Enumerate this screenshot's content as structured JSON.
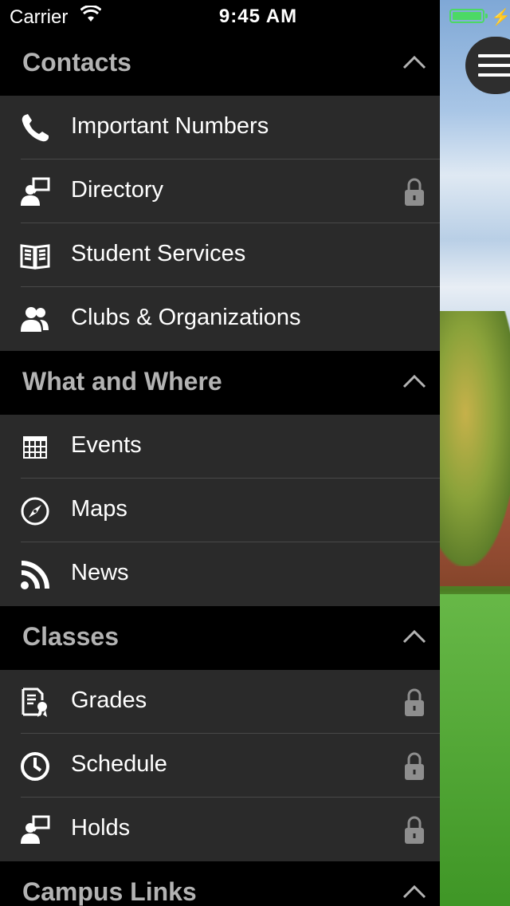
{
  "status_bar": {
    "carrier": "Carrier",
    "time": "9:45 AM",
    "battery_color": "#4cd964"
  },
  "menu_button": {
    "icon": "hamburger-menu-icon"
  },
  "sections": [
    {
      "title": "Contacts",
      "expanded": true,
      "items": [
        {
          "label": "Important Numbers",
          "icon": "phone-icon",
          "locked": false
        },
        {
          "label": "Directory",
          "icon": "person-chat-icon",
          "locked": true
        },
        {
          "label": "Student Services",
          "icon": "book-icon",
          "locked": false
        },
        {
          "label": "Clubs & Organizations",
          "icon": "people-icon",
          "locked": false
        }
      ]
    },
    {
      "title": "What and Where",
      "expanded": true,
      "items": [
        {
          "label": "Events",
          "icon": "calendar-icon",
          "locked": false
        },
        {
          "label": "Maps",
          "icon": "compass-icon",
          "locked": false
        },
        {
          "label": "News",
          "icon": "rss-icon",
          "locked": false
        }
      ]
    },
    {
      "title": "Classes",
      "expanded": true,
      "items": [
        {
          "label": "Grades",
          "icon": "certificate-icon",
          "locked": true
        },
        {
          "label": "Schedule",
          "icon": "clock-icon",
          "locked": true
        },
        {
          "label": "Holds",
          "icon": "person-chat-icon",
          "locked": true
        }
      ]
    },
    {
      "title": "Campus Links",
      "expanded": true,
      "items": []
    }
  ],
  "colors": {
    "header_bg": "#000000",
    "item_bg": "#2a2a2a",
    "header_text": "#b3b3b3",
    "item_text": "#ffffff",
    "lock_color": "#8e8e8e"
  }
}
